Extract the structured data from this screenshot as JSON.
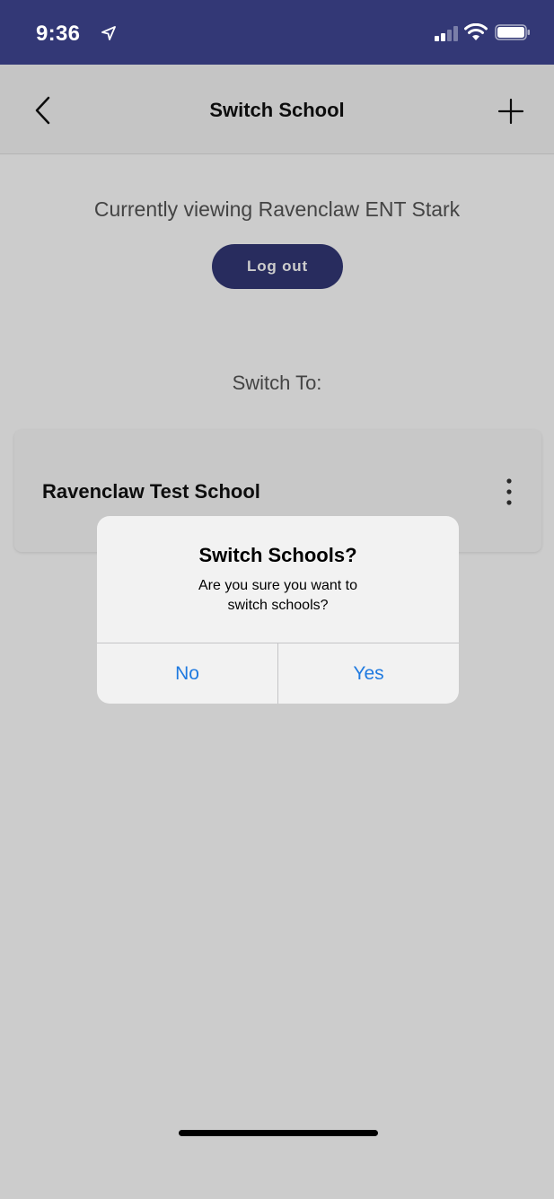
{
  "status_bar": {
    "time": "9:36"
  },
  "nav": {
    "title": "Switch School"
  },
  "main": {
    "current_text": "Currently viewing Ravenclaw ENT Stark",
    "logout_label": "Log out",
    "switch_to_label": "Switch To:",
    "schools": [
      {
        "name": "Ravenclaw Test School"
      }
    ]
  },
  "alert": {
    "title": "Switch Schools?",
    "message_line1": "Are you sure you want to",
    "message_line2": "switch schools?",
    "no_label": "No",
    "yes_label": "Yes"
  },
  "colors": {
    "brand": "#333876",
    "alert_button": "#1f7ae0",
    "overlay": "rgba(0,0,0,0.2)"
  },
  "icons": [
    "location-arrow-icon",
    "signal-icon",
    "wifi-icon",
    "battery-icon",
    "back-chevron-icon",
    "plus-icon",
    "more-vertical-icon"
  ]
}
